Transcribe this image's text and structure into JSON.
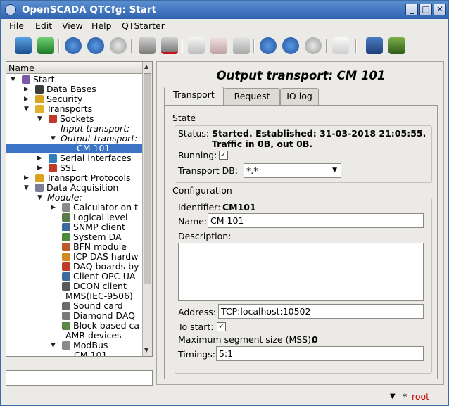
{
  "window": {
    "title": "OpenSCADA QTCfg: Start",
    "buttons": [
      "_",
      "□",
      "✕"
    ]
  },
  "menu": [
    "File",
    "Edit",
    "View",
    "Help",
    "QTStarter"
  ],
  "tree": {
    "header": "Name",
    "items": [
      {
        "label": "Start",
        "depth": 0,
        "exp": "open",
        "ico": "#7a5aa8",
        "italic": false
      },
      {
        "label": "Data Bases",
        "depth": 1,
        "exp": "closed",
        "ico": "#3b3b3b",
        "italic": false
      },
      {
        "label": "Security",
        "depth": 1,
        "exp": "closed",
        "ico": "#d9a520",
        "italic": false
      },
      {
        "label": "Transports",
        "depth": 1,
        "exp": "open",
        "ico": "#e0b02a",
        "italic": false
      },
      {
        "label": "Sockets",
        "depth": 2,
        "exp": "open",
        "ico": "#c03a2a",
        "italic": false
      },
      {
        "label": "Input transport:",
        "depth": 3,
        "exp": "none",
        "ico": null,
        "italic": true
      },
      {
        "label": "Output transport:",
        "depth": 3,
        "exp": "open",
        "ico": null,
        "italic": true
      },
      {
        "label": "CM 101",
        "depth": 4,
        "exp": "none",
        "ico": null,
        "italic": false,
        "selected": true
      },
      {
        "label": "Serial interfaces",
        "depth": 2,
        "exp": "closed",
        "ico": "#2f7fc0",
        "italic": false
      },
      {
        "label": "SSL",
        "depth": 2,
        "exp": "closed",
        "ico": "#c03a2a",
        "italic": false
      },
      {
        "label": "Transport Protocols",
        "depth": 1,
        "exp": "closed",
        "ico": "#d9a520",
        "italic": false
      },
      {
        "label": "Data Acquisition",
        "depth": 1,
        "exp": "open",
        "ico": "#7d7d9a",
        "italic": false
      },
      {
        "label": "Module:",
        "depth": 2,
        "exp": "open",
        "ico": null,
        "italic": true
      },
      {
        "label": "Calculator on t",
        "depth": 3,
        "exp": "closed",
        "ico": "#8a8a8a",
        "italic": false
      },
      {
        "label": "Logical level",
        "depth": 3,
        "exp": "none",
        "ico": "#5a7a4a",
        "italic": false
      },
      {
        "label": "SNMP client",
        "depth": 3,
        "exp": "none",
        "ico": "#3a6aa0",
        "italic": false
      },
      {
        "label": "System DA",
        "depth": 3,
        "exp": "none",
        "ico": "#4a8a3a",
        "italic": false
      },
      {
        "label": "BFN module",
        "depth": 3,
        "exp": "none",
        "ico": "#c05a2a",
        "italic": false
      },
      {
        "label": "ICP DAS hardw",
        "depth": 3,
        "exp": "none",
        "ico": "#d08a20",
        "italic": false
      },
      {
        "label": "DAQ boards by",
        "depth": 3,
        "exp": "none",
        "ico": "#c03a2a",
        "italic": false
      },
      {
        "label": "Client OPC-UA",
        "depth": 3,
        "exp": "none",
        "ico": "#3a6aa0",
        "italic": false
      },
      {
        "label": "DCON client",
        "depth": 3,
        "exp": "none",
        "ico": "#5a5a5a",
        "italic": false
      },
      {
        "label": "MMS(IEC-9506)",
        "depth": 2,
        "exp": "none",
        "ico": null,
        "italic": false
      },
      {
        "label": "Sound card",
        "depth": 3,
        "exp": "none",
        "ico": "#6a6a6a",
        "italic": false
      },
      {
        "label": "Diamond DAQ",
        "depth": 3,
        "exp": "none",
        "ico": "#7a7a7a",
        "italic": false
      },
      {
        "label": "Block based ca",
        "depth": 3,
        "exp": "none",
        "ico": "#5a8a4a",
        "italic": false
      },
      {
        "label": "AMR devices",
        "depth": 2,
        "exp": "none",
        "ico": null,
        "italic": false
      },
      {
        "label": "ModBus",
        "depth": 3,
        "exp": "open",
        "ico": "#8a8a8a",
        "italic": false
      },
      {
        "label": "CM 101",
        "depth": 4,
        "exp": "none",
        "ico": null,
        "italic": false
      }
    ]
  },
  "panel": {
    "title": "Output transport: CM 101",
    "tabs": [
      "Transport",
      "Request",
      "IO log"
    ],
    "state": {
      "section": "State",
      "status_label": "Status:",
      "status_line1": "Started. Established: 31-03-2018 21:05:55.",
      "status_line2": "Traffic in 0B, out 0B.",
      "running_label": "Running:",
      "running_check": "✓",
      "db_label": "Transport DB:",
      "db_value": "*.*"
    },
    "config": {
      "section": "Configuration",
      "id_label": "Identifier:",
      "id_value": "CM101",
      "name_label": "Name:",
      "name_value": "CM 101",
      "desc_label": "Description:",
      "desc_value": "",
      "addr_label": "Address:",
      "addr_value": "TCP:localhost:10502",
      "tostart_label": "To start:",
      "tostart_check": "✓",
      "mss_label": "Maximum segment size (MSS):",
      "mss_value": "0",
      "timings_label": "Timings:",
      "timings_value": "5:1"
    }
  },
  "footer": {
    "arrow": "▼",
    "star": "*",
    "user": "root",
    "user_color": "#c00000"
  }
}
